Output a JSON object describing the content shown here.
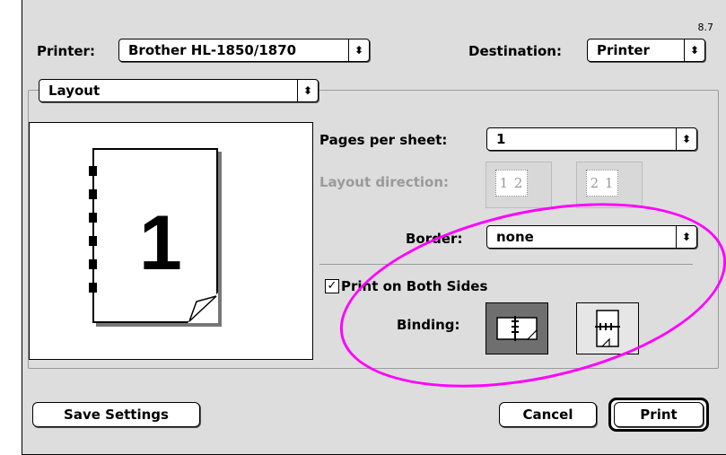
{
  "version": "8.7",
  "printer": {
    "label": "Printer:",
    "value": "Brother HL-1850/1870"
  },
  "destination": {
    "label": "Destination:",
    "value": "Printer"
  },
  "panel_selector": {
    "value": "Layout"
  },
  "preview": {
    "page_number": "1"
  },
  "layout": {
    "pages_per_sheet_label": "Pages per sheet:",
    "pages_per_sheet_value": "1",
    "layout_direction_label": "Layout direction:",
    "direction_left_to_right": "1 2",
    "direction_right_to_left": "2 1",
    "border_label": "Border:",
    "border_value": "none"
  },
  "duplex": {
    "checkbox_label": "Print on Both Sides",
    "checked": true,
    "binding_label": "Binding:"
  },
  "buttons": {
    "save_settings": "Save Settings",
    "cancel": "Cancel",
    "print": "Print"
  },
  "colors": {
    "dialog_bg": "#dddddd",
    "highlight_ellipse": "#ff00ff",
    "selected_binding": "#6f6f6f"
  },
  "icons": {
    "popup_arrow": "updown-arrows-icon",
    "checkmark": "checkmark-icon",
    "binding_long_edge": "binding-long-edge-icon",
    "binding_short_edge": "binding-short-edge-icon"
  }
}
